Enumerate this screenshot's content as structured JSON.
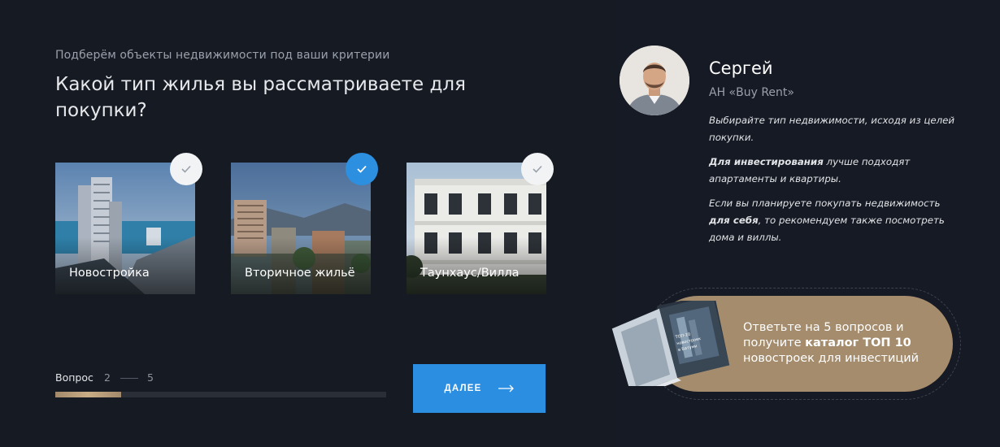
{
  "quiz": {
    "subtitle": "Подберём объекты недвижимости под ваши критерии",
    "question": "Какой тип жилья вы рассматриваете для покупки?",
    "options": [
      {
        "label": "Новостройка",
        "selected": false
      },
      {
        "label": "Вторичное жильё",
        "selected": true
      },
      {
        "label": "Таунхаус/Вилла",
        "selected": false
      }
    ],
    "progress": {
      "label": "Вопрос",
      "current": "2",
      "total": "5",
      "fraction": 0.2
    },
    "next_button": {
      "label": "ДАЛЕЕ",
      "icon": "arrow-right-icon"
    }
  },
  "agent": {
    "name": "Сергей",
    "company": "АН «Buy Rent»",
    "advice_1": "Выбирайте тип недвижимости, исходя из целей покупки.",
    "advice_2_bold": "Для инвестирования",
    "advice_2_rest": " лучше подходят апартаменты и квартиры.",
    "advice_3_start": "Если вы планируете покупать недвижимость ",
    "advice_3_bold": "для себя",
    "advice_3_rest": ", то рекомендуем также посмотреть дома и виллы."
  },
  "promo": {
    "text_start": "Ответьте на 5 вопросов и получите ",
    "text_bold": "каталог ТОП 10",
    "text_end": " новостроек для инвестиций",
    "book_title": "ТОП-10 новостроек в Батуми"
  },
  "colors": {
    "background": "#161a23",
    "accent": "#2b8ee0",
    "gold": "#a48c6d"
  }
}
